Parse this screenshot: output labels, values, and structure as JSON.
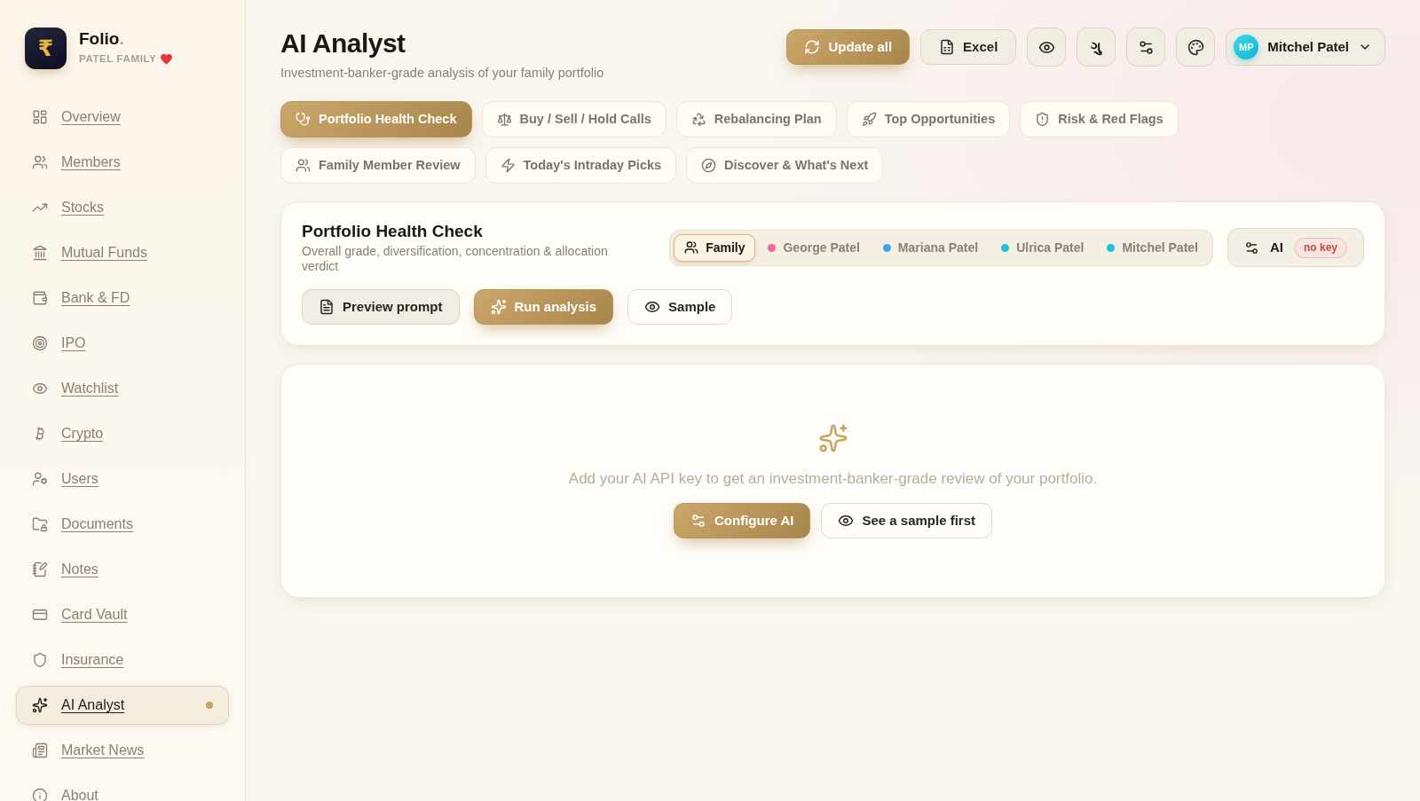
{
  "sidebar": {
    "logo": "₹",
    "brand": "Folio",
    "brand_dot": ".",
    "family": "PATEL FAMILY",
    "items": [
      {
        "label": "Overview",
        "selected": false
      },
      {
        "label": "Members",
        "selected": false
      },
      {
        "label": "Stocks",
        "selected": false
      },
      {
        "label": "Mutual Funds",
        "selected": false
      },
      {
        "label": "Bank & FD",
        "selected": false
      },
      {
        "label": "IPO",
        "selected": false
      },
      {
        "label": "Watchlist",
        "selected": false
      },
      {
        "label": "Crypto",
        "selected": false
      },
      {
        "label": "Users",
        "selected": false
      },
      {
        "label": "Documents",
        "selected": false
      },
      {
        "label": "Notes",
        "selected": false
      },
      {
        "label": "Card Vault",
        "selected": false
      },
      {
        "label": "Insurance",
        "selected": false
      },
      {
        "label": "AI Analyst",
        "selected": true
      },
      {
        "label": "Market News",
        "selected": false
      },
      {
        "label": "About",
        "selected": false
      }
    ]
  },
  "header": {
    "title": "AI Analyst",
    "subtitle": "Investment-banker-grade analysis of your family portfolio",
    "update_button": "Update all",
    "excel_button": "Excel",
    "language_button": "ગુ",
    "user": {
      "initials": "MP",
      "name": "Mitchel Patel"
    }
  },
  "tabs": [
    {
      "label": "Portfolio Health Check",
      "selected": true
    },
    {
      "label": "Buy / Sell / Hold Calls",
      "selected": false
    },
    {
      "label": "Rebalancing Plan",
      "selected": false
    },
    {
      "label": "Top Opportunities",
      "selected": false
    },
    {
      "label": "Risk & Red Flags",
      "selected": false
    },
    {
      "label": "Family Member Review",
      "selected": false
    },
    {
      "label": "Today's Intraday Picks",
      "selected": false
    },
    {
      "label": "Discover & What's Next",
      "selected": false
    }
  ],
  "analysis_card": {
    "title": "Portfolio Health Check",
    "description": "Overall grade, diversification, concentration & allocation verdict",
    "members": [
      {
        "kind": "group",
        "label": "Family",
        "selected": true
      },
      {
        "kind": "person",
        "label": "George Patel",
        "selected": false,
        "color": "#ec6a9c"
      },
      {
        "kind": "person",
        "label": "Mariana Patel",
        "selected": false,
        "color": "#3ba7ea"
      },
      {
        "kind": "person",
        "label": "Ulrica Patel",
        "selected": false,
        "color": "#22c0dc"
      },
      {
        "kind": "person",
        "label": "Mitchel Patel",
        "selected": false,
        "color": "#22c0dc"
      }
    ],
    "ai_status": {
      "label": "AI",
      "badge": "no key"
    },
    "actions": [
      {
        "kind": "secondary",
        "label": "Preview prompt"
      },
      {
        "kind": "primary",
        "label": "Run analysis"
      },
      {
        "kind": "outline",
        "label": "Sample"
      }
    ]
  },
  "empty_state": {
    "message": "Add your AI API key to get an investment-banker-grade review of your portfolio.",
    "actions": [
      {
        "kind": "primary",
        "label": "Configure AI"
      },
      {
        "kind": "outline",
        "label": "See a sample first"
      }
    ]
  }
}
